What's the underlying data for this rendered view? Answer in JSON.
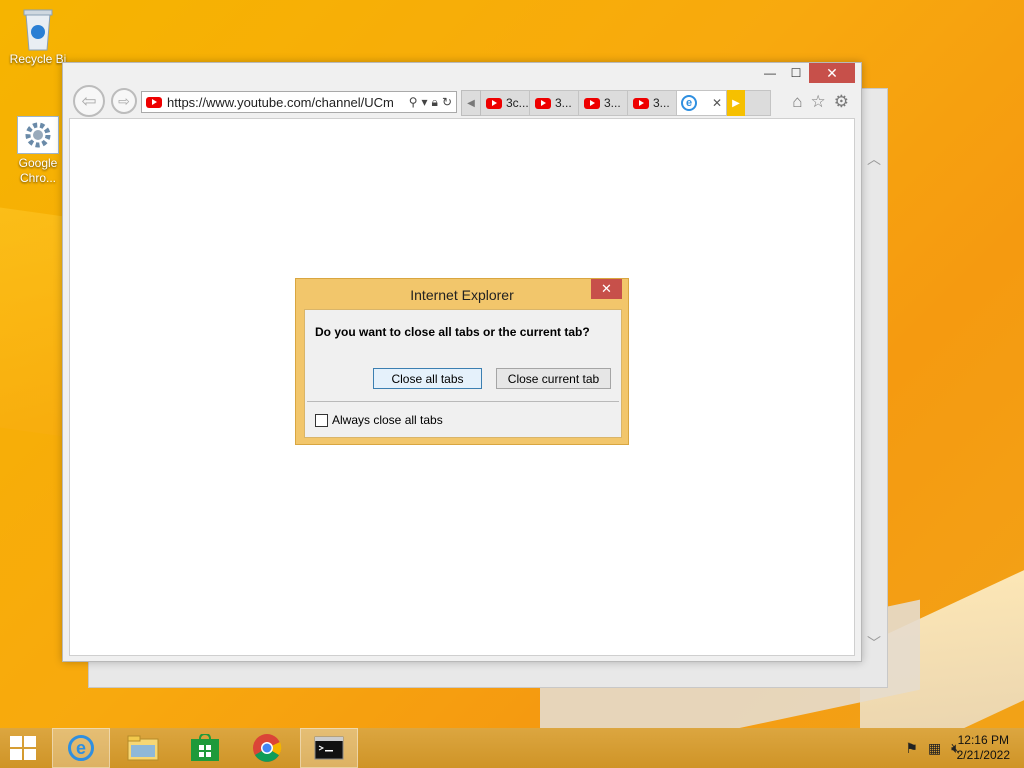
{
  "desktop": {
    "icons": [
      {
        "label": "Recycle Bi",
        "icon": "recycle-bin-icon"
      },
      {
        "label": "Google Chro...",
        "icon": "settings-shortcut-icon"
      }
    ]
  },
  "browser": {
    "address": "https://www.youtube.com/channel/UCm",
    "tabs": [
      {
        "label": "3c..."
      },
      {
        "label": "3..."
      },
      {
        "label": "3..."
      },
      {
        "label": "3..."
      }
    ],
    "active_tab_close": "✕"
  },
  "dialog": {
    "title": "Internet Explorer",
    "question": "Do you want to close all tabs or the current tab?",
    "close_all_label": "Close all tabs",
    "close_current_label": "Close current tab",
    "checkbox_label": "Always close all tabs",
    "checkbox_checked": false
  },
  "taskbar": {
    "time": "12:16 PM",
    "date": "2/21/2022"
  },
  "colors": {
    "accent": "#f6b400",
    "close_red": "#c7504a",
    "dialog_frame": "#f2c66b"
  }
}
